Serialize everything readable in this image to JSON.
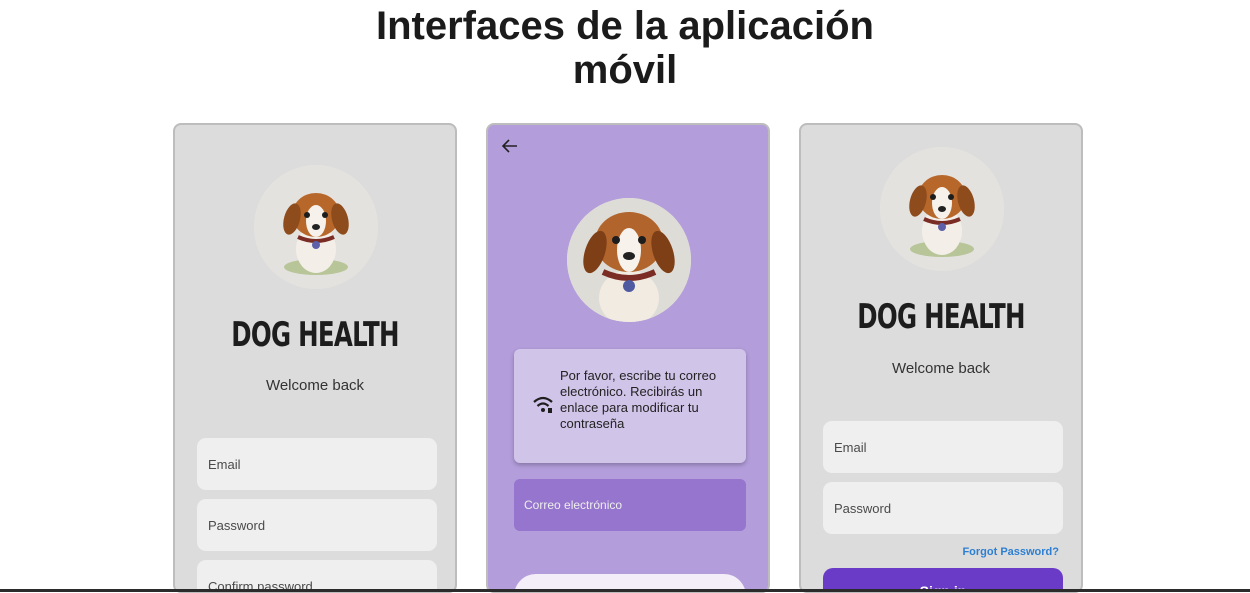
{
  "page": {
    "heading_line1": "Interfaces de la aplicación",
    "heading_line2": "móvil"
  },
  "screen_signup": {
    "brand": "DOG HEALTH",
    "subtitle": "Welcome back",
    "email_placeholder": "Email",
    "password_placeholder": "Password",
    "confirm_placeholder": "Confirm password"
  },
  "screen_reset": {
    "message": "Por favor, escribe tu correo electrónico. Recibirás un enlace para modificar tu contraseña",
    "email_placeholder": "Correo electrónico"
  },
  "screen_login": {
    "brand": "DOG HEALTH",
    "subtitle": "Welcome back",
    "email_placeholder": "Email",
    "password_placeholder": "Password",
    "forgot_link": "Forgot Password?",
    "submit_label": "Sign in"
  },
  "colors": {
    "grey_screen": "#dcdcdc",
    "purple_screen": "#b39ddb",
    "primary_button": "#6a3bc7",
    "link": "#2d7fd3"
  },
  "icons": [
    "dog-avatar-icon",
    "back-arrow-icon",
    "wifi-icon"
  ]
}
